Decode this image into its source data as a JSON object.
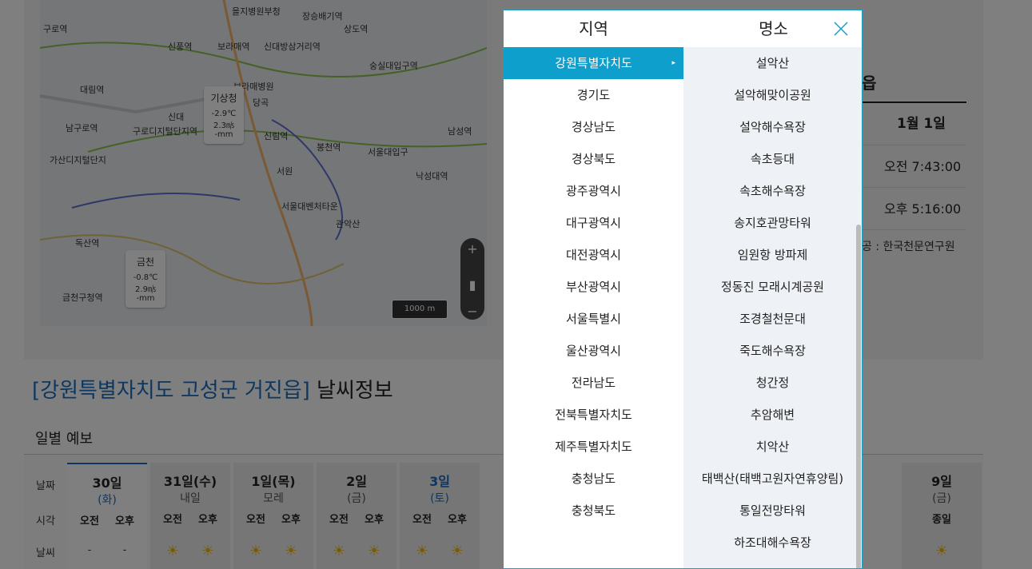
{
  "map": {
    "labels": [
      "을지병원부청",
      "장승배기역",
      "상도역",
      "구로역",
      "신풍역",
      "보라매역",
      "신대방삼거리역",
      "숭실대입구역",
      "보라매병원",
      "대림역",
      "당곡",
      "남구로역",
      "구로디지털단지역",
      "신대",
      "신림역",
      "봉천역",
      "서울대입구",
      "남성역",
      "가산디지털단지",
      "서원",
      "낙성대역",
      "서울대벤처타운",
      "관악산",
      "독산역",
      "금천구청역"
    ],
    "cards": [
      {
        "city": "기상청",
        "temp": "-2.9℃",
        "wind": "2.3㎧",
        "rain": "-mm"
      },
      {
        "city": "금천",
        "temp": "-0.8℃",
        "wind": "2.9㎧",
        "rain": "-mm"
      }
    ],
    "scale": "1000 m"
  },
  "sun": {
    "heading": "읍",
    "date_header": "1월 1일",
    "rise": "오전 7:43:00",
    "set": "오후 5:16:00",
    "source": "공 : 한국천문연구원"
  },
  "region_title": {
    "highlight": "[강원특별자치도 고성군 거진읍]",
    "rest": " 날씨정보"
  },
  "daily": {
    "title": "일별 예보",
    "row_labels": [
      "날짜",
      "시각",
      "날씨"
    ],
    "am": "오전",
    "pm": "오후",
    "days": [
      {
        "day": "30일",
        "sub": "(화)"
      },
      {
        "day": "31일(수)",
        "sub": "내일"
      },
      {
        "day": "1일(목)",
        "sub": "모레"
      },
      {
        "day": "2일",
        "sub": "(금)"
      },
      {
        "day": "3일",
        "sub": "(토)"
      }
    ],
    "last_day": {
      "day": "9일",
      "sub": "(금)",
      "time": "종일"
    },
    "dash": "-",
    "sun_icon": "☀"
  },
  "modal": {
    "tab_region": "지역",
    "tab_place": "명소",
    "close_icon": "close-icon",
    "accent": "#0f9fcc",
    "regions": [
      "강원특별자치도",
      "경기도",
      "경상남도",
      "경상북도",
      "광주광역시",
      "대구광역시",
      "대전광역시",
      "부산광역시",
      "서울특별시",
      "울산광역시",
      "전라남도",
      "전북특별자치도",
      "제주특별자치도",
      "충청남도",
      "충청북도"
    ],
    "active_region": "강원특별자치도",
    "active_arrow": "▸",
    "places": [
      "설악산",
      "설악해맞이공원",
      "설악해수욕장",
      "속초등대",
      "속초해수욕장",
      "송지호관망타워",
      "임원항 방파제",
      "정동진 모래시계공원",
      "조경철천문대",
      "죽도해수욕장",
      "청간정",
      "추암해변",
      "치악산",
      "태백산(태백고원자연휴양림)",
      "통일전망타워",
      "하조대해수욕장"
    ]
  }
}
